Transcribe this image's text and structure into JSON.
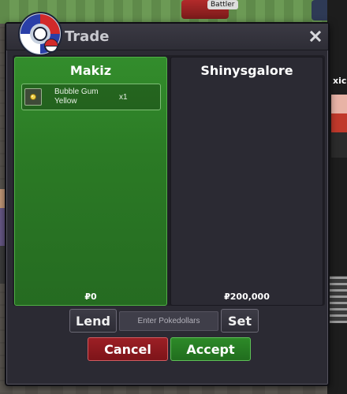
{
  "world": {
    "npc_name_tag": "Battler",
    "npc_speech": "xic"
  },
  "dialog": {
    "title": "Trade",
    "close_icon": "close-icon",
    "logo_icon": "pokeball-logo-icon"
  },
  "left_panel": {
    "player": "Makiz",
    "money": "₽0",
    "items": [
      {
        "icon": "bubble-gum-icon",
        "name": "Bubble Gum Yellow",
        "qty": "x1"
      }
    ]
  },
  "right_panel": {
    "player": "Shinysgalore",
    "money": "₽200,000",
    "items": []
  },
  "controls": {
    "lend_label": "Lend",
    "money_placeholder": "Enter Pokedollars",
    "set_label": "Set",
    "cancel_label": "Cancel",
    "accept_label": "Accept"
  },
  "colors": {
    "left_panel_bg": "#2b7a25",
    "right_panel_bg": "#2b2a33",
    "cancel_bg": "#8f1a20",
    "accept_bg": "#28802a"
  }
}
